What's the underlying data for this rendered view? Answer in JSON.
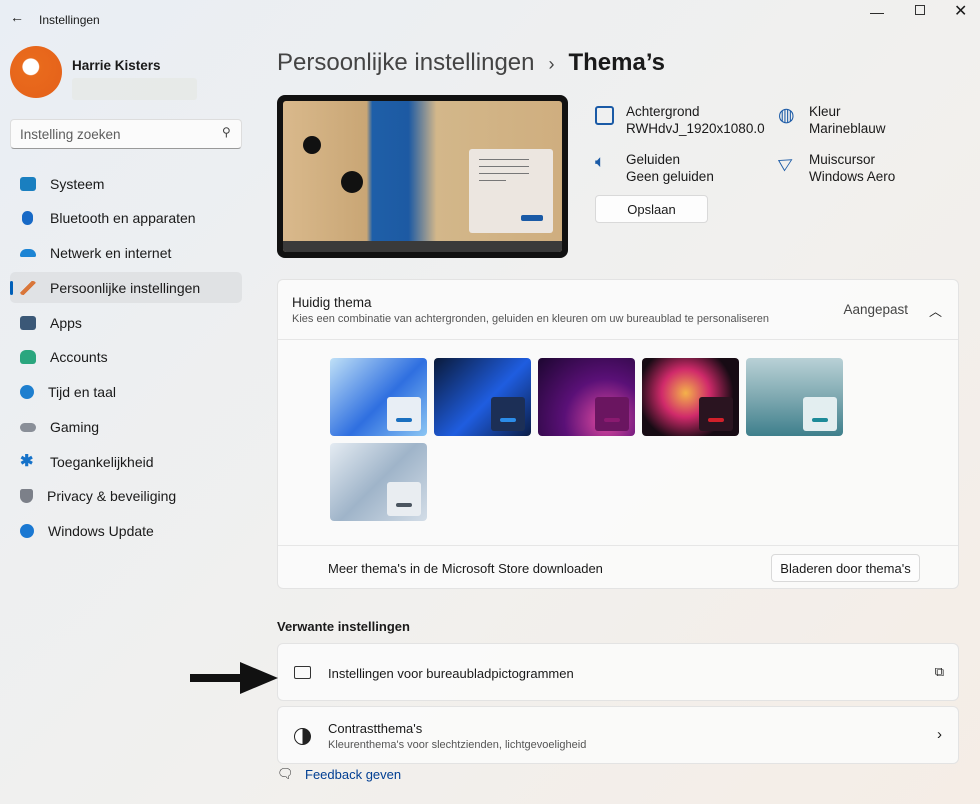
{
  "window": {
    "title": "Instellingen"
  },
  "user": {
    "name": "Harrie Kisters"
  },
  "search": {
    "placeholder": "Instelling zoeken"
  },
  "sidebar": {
    "items": [
      {
        "label": "Systeem",
        "color": "#1a7fc0"
      },
      {
        "label": "Bluetooth en apparaten",
        "color": "#1769c6"
      },
      {
        "label": "Netwerk en internet",
        "color": "#1c84d4"
      },
      {
        "label": "Persoonlijke instellingen",
        "color": "#d9763a",
        "active": true
      },
      {
        "label": "Apps",
        "color": "#3b5877"
      },
      {
        "label": "Accounts",
        "color": "#2aa67e"
      },
      {
        "label": "Tijd en taal",
        "color": "#1e7fcf"
      },
      {
        "label": "Gaming",
        "color": "#8a8f98"
      },
      {
        "label": "Toegankelijkheid",
        "color": "#1572c9"
      },
      {
        "label": "Privacy & beveiliging",
        "color": "#7c8089"
      },
      {
        "label": "Windows Update",
        "color": "#1a78d2"
      }
    ]
  },
  "breadcrumb": {
    "parent": "Persoonlijke instellingen",
    "separator": "›",
    "current": "Thema’s"
  },
  "theme_info": {
    "background": {
      "label": "Achtergrond",
      "value": "RWHdvJ_1920x1080.0"
    },
    "color": {
      "label": "Kleur",
      "value": "Marineblauw"
    },
    "sounds": {
      "label": "Geluiden",
      "value": "Geen geluiden"
    },
    "cursor": {
      "label": "Muiscursor",
      "value": "Windows Aero"
    },
    "save_label": "Opslaan"
  },
  "current_theme": {
    "title": "Huidig thema",
    "description": "Kies een combinatie van achtergronden, geluiden en kleuren om uw bureaublad te personaliseren",
    "value": "Aangepast",
    "themes": [
      {
        "bg": "linear-gradient(135deg,#bfe0f7,#2f6fe0 55%,#8cc6f3)",
        "win": "#e8eef5",
        "bar": "#1a6fbf"
      },
      {
        "bg": "linear-gradient(135deg,#0a1a3a,#1f5de0 55%,#0b1d46)",
        "win": "#1c2f56",
        "bar": "#2c8ce8"
      },
      {
        "bg": "radial-gradient(circle at 70% 80%,#e04aa0,#5a1077 45%,#1c0630)",
        "win": "#6a1560",
        "bar": "#8a1a70"
      },
      {
        "bg": "radial-gradient(circle at 45% 45%,#f4b24a,#d02a6a 35%,#170b14 70%)",
        "win": "#2a1420",
        "bar": "#d2202a"
      },
      {
        "bg": "linear-gradient(180deg,#b9d1d6,#7fa9b1 50%,#3e7f8c)",
        "win": "#e3eef0",
        "bar": "#1c8a98"
      },
      {
        "bg": "linear-gradient(135deg,#e4ebf2,#9fb4c9 50%,#d3dde7)",
        "win": "#e9edf1",
        "bar": "#4b5560"
      }
    ]
  },
  "store": {
    "text": "Meer thema's in de Microsoft Store downloaden",
    "button": "Bladeren door thema's"
  },
  "related": {
    "heading": "Verwante instellingen",
    "desktop_icons": {
      "label": "Instellingen voor bureaubladpictogrammen"
    },
    "contrast": {
      "label": "Contrastthema's",
      "description": "Kleurenthema's voor slechtzienden, lichtgevoeligheid"
    }
  },
  "feedback": {
    "label": "Feedback geven"
  },
  "accent": "#005fb8"
}
